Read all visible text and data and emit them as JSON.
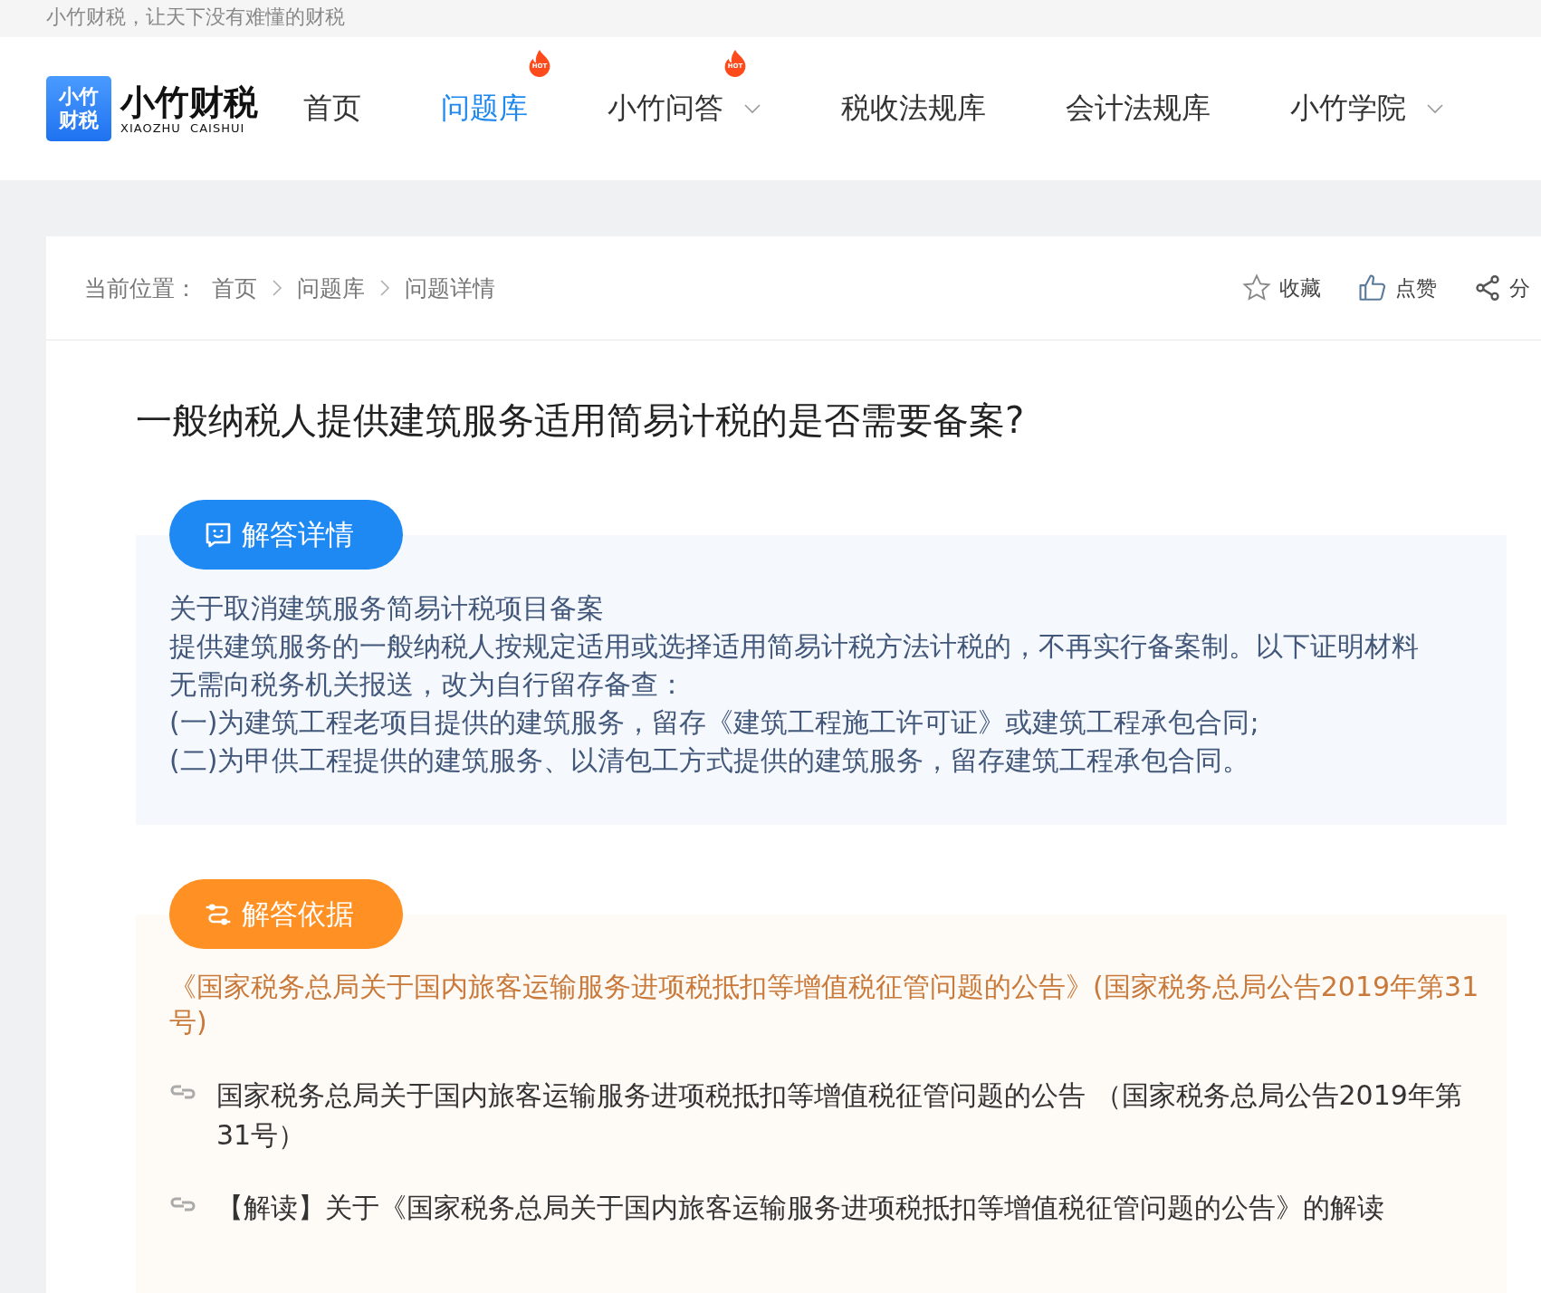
{
  "tagline": "小竹财税，让天下没有难懂的财税",
  "logo": {
    "mark_top": "小竹",
    "mark_bottom": "财税",
    "name": "小竹财税",
    "latin": "XIAOZHU  CAISHUI"
  },
  "nav": [
    {
      "label": "首页",
      "selected": false,
      "hot": false,
      "dropdown": false
    },
    {
      "label": "问题库",
      "selected": true,
      "hot": true,
      "badge": "HOT",
      "dropdown": false
    },
    {
      "label": "小竹问答",
      "selected": false,
      "hot": true,
      "badge": "HOT",
      "dropdown": true
    },
    {
      "label": "税收法规库",
      "selected": false,
      "hot": false,
      "dropdown": false
    },
    {
      "label": "会计法规库",
      "selected": false,
      "hot": false,
      "dropdown": false
    },
    {
      "label": "小竹学院",
      "selected": false,
      "hot": false,
      "dropdown": true
    }
  ],
  "breadcrumb": {
    "prefix": "当前位置：",
    "items": [
      "首页",
      "问题库",
      "问题详情"
    ]
  },
  "actions": [
    {
      "kind": "star",
      "label": "收藏"
    },
    {
      "kind": "like",
      "label": "点赞"
    },
    {
      "kind": "share",
      "label": "分"
    }
  ],
  "question": "一般纳税人提供建筑服务适用简易计税的是否需要备案?",
  "answer": {
    "button": "解答详情",
    "paragraphs": [
      "关于取消建筑服务简易计税项目备案",
      "提供建筑服务的一般纳税人按规定适用或选择适用简易计税方法计税的，不再实行备案制。以下证明材料无需向税务机关报送，改为自行留存备查：",
      "(一)为建筑工程老项目提供的建筑服务，留存《建筑工程施工许可证》或建筑工程承包合同;",
      "(二)为甲供工程提供的建筑服务、以清包工方式提供的建筑服务，留存建筑工程承包合同。"
    ]
  },
  "basis": {
    "button": "解答依据",
    "source": "《国家税务总局关于国内旅客运输服务进项税抵扣等增值税征管问题的公告》(国家税务总局公告2019年第31号)",
    "links": [
      "国家税务总局关于国内旅客运输服务进项税抵扣等增值税征管问题的公告 （国家税务总局公告2019年第31号）",
      "【解读】关于《国家税务总局关于国内旅客运输服务进项税抵扣等增值税征管问题的公告》的解读"
    ]
  }
}
